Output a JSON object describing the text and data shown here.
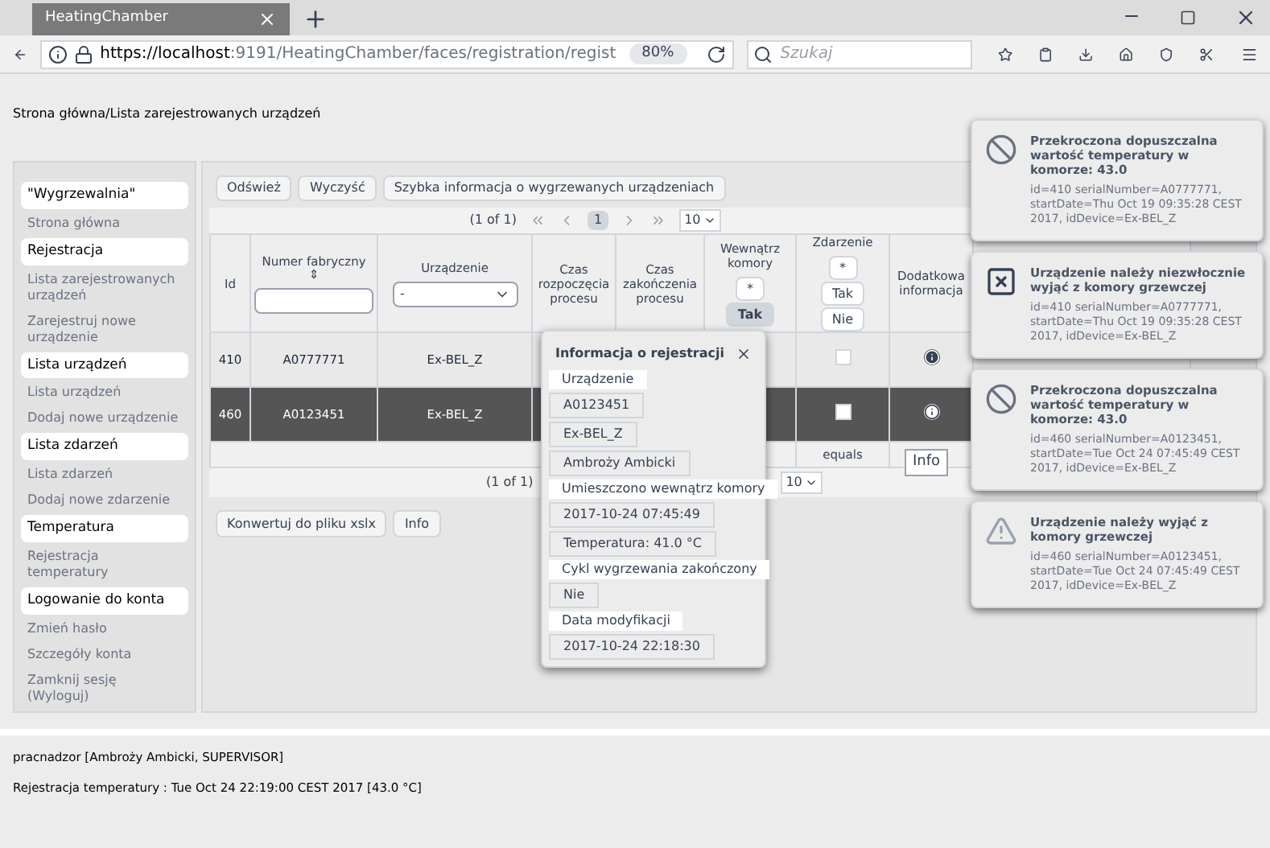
{
  "browser": {
    "tab_title": "HeatingChamber",
    "url_host": "https://localhost",
    "url_rest": ":9191/HeatingChamber/faces/registration/regist",
    "zoom": "80%",
    "search_placeholder": "Szukaj"
  },
  "breadcrumb": "Strona główna/Lista zarejestrowanych urządzeń",
  "sidebar": [
    {
      "kind": "header",
      "label": "\"Wygrzewalnia\""
    },
    {
      "kind": "link",
      "label": "Strona główna"
    },
    {
      "kind": "header",
      "label": "Rejestracja"
    },
    {
      "kind": "link",
      "label": "Lista zarejestrowanych urządzeń"
    },
    {
      "kind": "link",
      "label": "Zarejestruj nowe urządzenie"
    },
    {
      "kind": "header",
      "label": "Lista urządzeń"
    },
    {
      "kind": "link",
      "label": "Lista urządzeń"
    },
    {
      "kind": "link",
      "label": "Dodaj nowe urządzenie"
    },
    {
      "kind": "header",
      "label": "Lista zdarzeń"
    },
    {
      "kind": "link",
      "label": "Lista zdarzeń"
    },
    {
      "kind": "link",
      "label": "Dodaj nowe zdarzenie"
    },
    {
      "kind": "header",
      "label": "Temperatura"
    },
    {
      "kind": "link",
      "label": "Rejestracja temperatury"
    },
    {
      "kind": "header",
      "label": "Logowanie do konta"
    },
    {
      "kind": "link",
      "label": "Zmień hasło"
    },
    {
      "kind": "link",
      "label": "Szczegóły konta"
    },
    {
      "kind": "link",
      "label": "Zamknij sesję (Wyloguj)"
    }
  ],
  "toolbar": [
    "Odśwież",
    "Wyczyść",
    "Szybka informacja o wygrzewanych urządzeniach"
  ],
  "paginator": {
    "status": "(1 of 1)",
    "page": "1",
    "rows": "10"
  },
  "table": {
    "columns": [
      {
        "label": "Id"
      },
      {
        "label": "Numer fabryczny",
        "sort": "⇕",
        "kind": "text"
      },
      {
        "label": "Urządzenie",
        "kind": "select",
        "value": "-"
      },
      {
        "label": "Czas rozpoczęcia procesu"
      },
      {
        "label": "Czas zakończenia procesu"
      },
      {
        "label": "Wewnątrz komory",
        "kind": "toggle",
        "options": [
          "*",
          "Tak"
        ]
      },
      {
        "label": "Zdarzenie",
        "kind": "toggle",
        "options": [
          "*",
          "Tak",
          "Nie"
        ]
      },
      {
        "label": "Dodatkowa informacja"
      }
    ],
    "rows": [
      {
        "id": "410",
        "serial": "A0777771",
        "device": "Ex-BEL_Z",
        "event_checked": false,
        "selected": false
      },
      {
        "id": "460",
        "serial": "A0123451",
        "device": "Ex-BEL_Z",
        "event_checked": false,
        "selected": true
      }
    ],
    "footer_filter": "equals"
  },
  "bottom_paginator": {
    "status": "(1 of 1)",
    "rows": "10"
  },
  "actions": [
    "Konwertuj do pliku xslx",
    "Info"
  ],
  "tooltip": "Info",
  "dialog": {
    "title": "Informacja o rejestracji",
    "fields": [
      {
        "kind": "label",
        "text": "Urządzenie"
      },
      {
        "kind": "value",
        "text": "A0123451"
      },
      {
        "kind": "value",
        "text": "Ex-BEL_Z"
      },
      {
        "kind": "value",
        "text": "Ambroży Ambicki"
      },
      {
        "kind": "label",
        "text": "Umieszczono wewnątrz komory"
      },
      {
        "kind": "value",
        "text": "2017-10-24 07:45:49"
      },
      {
        "kind": "value",
        "text": "Temperatura: 41.0 °C"
      },
      {
        "kind": "label",
        "text": "Cykl wygrzewania zakończony"
      },
      {
        "kind": "value",
        "text": "Nie"
      },
      {
        "kind": "label",
        "text": "Data modyfikacji"
      },
      {
        "kind": "value",
        "text": "2017-10-24 22:18:30"
      }
    ]
  },
  "notifications": [
    {
      "kind": "ban",
      "title": "Przekroczona dopuszczalna wartość temperatury w komorze: 43.0",
      "detail": "id=410 serialNumber=A0777771, startDate=Thu Oct 19 09:35:28 CEST 2017, idDevice=Ex-BEL_Z"
    },
    {
      "kind": "error",
      "title": "Urządzenie należy niezwłocznie wyjąć z komory grzewczej",
      "detail": "id=410 serialNumber=A0777771, startDate=Thu Oct 19 09:35:28 CEST 2017, idDevice=Ex-BEL_Z"
    },
    {
      "kind": "ban",
      "title": "Przekroczona dopuszczalna wartość temperatury w komorze: 43.0",
      "detail": "id=460 serialNumber=A0123451, startDate=Tue Oct 24 07:45:49 CEST 2017, idDevice=Ex-BEL_Z"
    },
    {
      "kind": "warning",
      "title": "Urządzenie należy wyjąć z komory grzewczej",
      "detail": "id=460 serialNumber=A0123451, startDate=Tue Oct 24 07:45:49 CEST 2017, idDevice=Ex-BEL_Z"
    }
  ],
  "status": [
    "pracnadzor [Ambroży Ambicki, SUPERVISOR]",
    "Rejestracja temperatury : Tue Oct 24 22:19:00 CEST 2017 [43.0 °C]"
  ]
}
